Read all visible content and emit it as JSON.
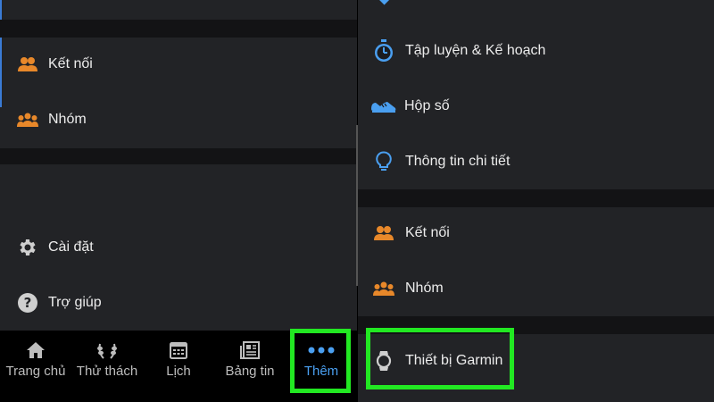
{
  "left_panel": {
    "items": [
      {
        "label": "Kết nối",
        "icon": "connections-icon"
      },
      {
        "label": "Nhóm",
        "icon": "groups-icon"
      },
      {
        "label": "Cài đặt",
        "icon": "gear-icon"
      },
      {
        "label": "Trợ giúp",
        "icon": "help-icon"
      }
    ]
  },
  "bottom_nav": {
    "items": [
      {
        "label": "Trang chủ",
        "icon": "home-icon"
      },
      {
        "label": "Thử thách",
        "icon": "laurel-icon"
      },
      {
        "label": "Lịch",
        "icon": "calendar-icon"
      },
      {
        "label": "Bảng tin",
        "icon": "newsfeed-icon"
      },
      {
        "label": "Thêm",
        "icon": "more-dots-icon",
        "active": true
      }
    ]
  },
  "right_panel": {
    "items": [
      {
        "label": "Tập luyện & Kế hoạch",
        "icon": "stopwatch-icon"
      },
      {
        "label": "Hộp số",
        "icon": "shoe-icon"
      },
      {
        "label": "Thông tin chi tiết",
        "icon": "lightbulb-icon"
      },
      {
        "label": "Kết nối",
        "icon": "connections-icon"
      },
      {
        "label": "Nhóm",
        "icon": "groups-icon"
      },
      {
        "label": "Thiết bị Garmin",
        "icon": "watch-icon"
      }
    ]
  },
  "colors": {
    "highlight": "#22e822",
    "accent_blue": "#4a9ff0",
    "accent_orange": "#e8882a"
  }
}
